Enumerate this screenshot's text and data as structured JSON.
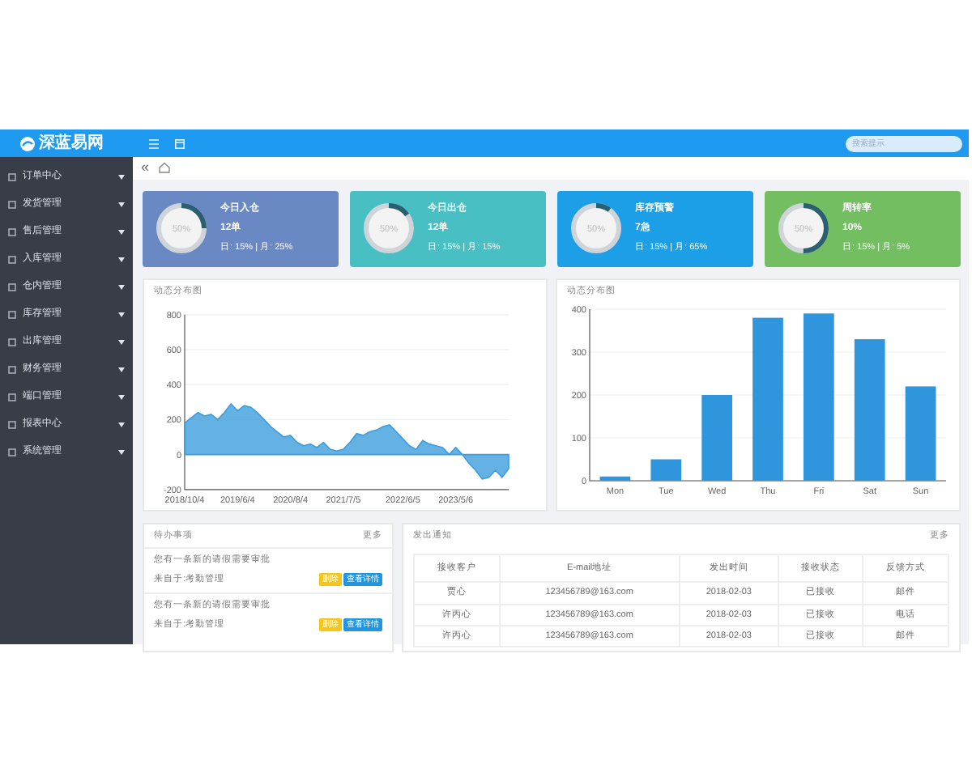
{
  "header": {
    "logo": "深蓝易网",
    "search": {
      "placeholder": "搜索提示"
    }
  },
  "sidebar": {
    "items": [
      {
        "label": "订单中心"
      },
      {
        "label": "发货管理"
      },
      {
        "label": "售后管理"
      },
      {
        "label": "入库管理"
      },
      {
        "label": "仓内管理"
      },
      {
        "label": "库存管理"
      },
      {
        "label": "出库管理"
      },
      {
        "label": "财务管理"
      },
      {
        "label": "端口管理"
      },
      {
        "label": "报表中心"
      },
      {
        "label": "系统管理"
      }
    ]
  },
  "tabbar": {
    "collapse": "«"
  },
  "stats": [
    {
      "title": "今日入仓",
      "value": "12单",
      "ring_label": "50%",
      "level": 0.25,
      "color": "#6a89c4",
      "summary": "日: 15% | 月: 25%"
    },
    {
      "title": "今日出仓",
      "value": "12单",
      "ring_label": "50%",
      "level": 0.15,
      "color": "#48bfc3",
      "summary": "日: 15% | 月: 15%"
    },
    {
      "title": "库存预警",
      "value": "7急",
      "ring_label": "50%",
      "level": 0.1,
      "color": "#1c9fe6",
      "summary": "日: 15% | 月: 65%"
    },
    {
      "title": "周转率",
      "value": "10%",
      "ring_label": "50%",
      "level": 0.5,
      "color": "#74be62",
      "summary": "日: 15% | 月: 5%"
    }
  ],
  "charts": [
    {
      "title": "动态分布图",
      "chart_data": {
        "type": "area",
        "grid": true,
        "categories": [
          "2018/10/4",
          null,
          null,
          null,
          null,
          null,
          null,
          null,
          "2019/6/4",
          null,
          null,
          null,
          null,
          null,
          null,
          null,
          "2020/8/4",
          null,
          null,
          null,
          null,
          null,
          null,
          null,
          "2021/7/5",
          null,
          null,
          null,
          null,
          null,
          null,
          null,
          null,
          "2022/6/5",
          null,
          null,
          null,
          null,
          null,
          null,
          null,
          "2023/5/6",
          null,
          null,
          null,
          null,
          null,
          null,
          null,
          null
        ],
        "ylim": [
          -200,
          800
        ],
        "yticks": [
          -200,
          0,
          200,
          400,
          600,
          800
        ],
        "values": [
          180,
          210,
          240,
          220,
          230,
          200,
          240,
          290,
          250,
          280,
          270,
          240,
          200,
          160,
          130,
          100,
          110,
          70,
          50,
          60,
          40,
          70,
          30,
          20,
          30,
          70,
          120,
          110,
          130,
          140,
          160,
          170,
          130,
          90,
          50,
          30,
          80,
          60,
          50,
          40,
          0,
          40,
          0,
          -50,
          -90,
          -140,
          -130,
          -90,
          -130,
          -80
        ]
      }
    },
    {
      "title": "动态分布图",
      "chart_data": {
        "type": "bar",
        "grid": true,
        "categories": [
          "Mon",
          "Tue",
          "Wed",
          "Thu",
          "Fri",
          "Sat",
          "Sun"
        ],
        "ylim": [
          0,
          400
        ],
        "yticks": [
          0,
          100,
          200,
          300,
          400
        ],
        "values": [
          10,
          50,
          200,
          380,
          390,
          330,
          220
        ]
      }
    }
  ],
  "todo": {
    "title": "待办事项",
    "more": "更多",
    "items": [
      {
        "text": "您有一条新的请假需要审批",
        "source": "来自于:考勤管理",
        "buttons": [
          {
            "label": "删除",
            "kind": "warning"
          },
          {
            "label": "查看详情",
            "kind": "primary"
          }
        ]
      },
      {
        "text": "您有一条新的请假需要审批",
        "source": "来自于:考勤管理",
        "buttons": [
          {
            "label": "删除",
            "kind": "warning"
          },
          {
            "label": "查看详情",
            "kind": "primary"
          }
        ]
      }
    ]
  },
  "notice": {
    "title": "发出通知",
    "more": "更多",
    "columns": [
      "接收客户",
      "E-mail地址",
      "发出时间",
      "接收状态",
      "反馈方式"
    ],
    "rows": [
      [
        "贾心",
        "123456789@163.com",
        "2018-02-03",
        "已接收",
        "邮件"
      ],
      [
        "许丙心",
        "123456789@163.com",
        "2018-02-03",
        "已接收",
        "电话"
      ],
      [
        "许丙心",
        "123456789@163.com",
        "2018-02-03",
        "已接收",
        "邮件"
      ]
    ]
  }
}
